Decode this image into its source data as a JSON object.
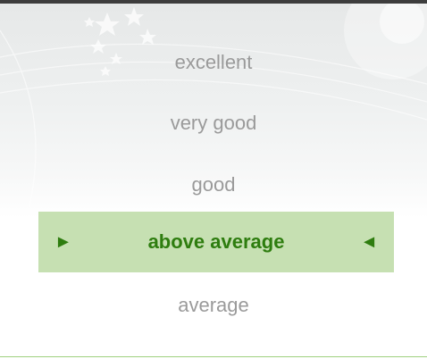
{
  "rating_picker": {
    "options": [
      {
        "label": "excellent"
      },
      {
        "label": "very good"
      },
      {
        "label": "good"
      },
      {
        "label": "above average"
      },
      {
        "label": "average"
      }
    ],
    "selected_index": 3,
    "selected_indicator_left": "►",
    "selected_indicator_right": "◄"
  },
  "colors": {
    "selected_background": "#c6e0b2",
    "selected_text": "#2e7d0f",
    "option_text": "#9a9a9a",
    "top_bar": "#3d3d3d",
    "divider": "#9fd07e"
  },
  "icons": [
    "decorative-stars-icon",
    "play-right-arrow-icon",
    "play-left-arrow-icon"
  ]
}
